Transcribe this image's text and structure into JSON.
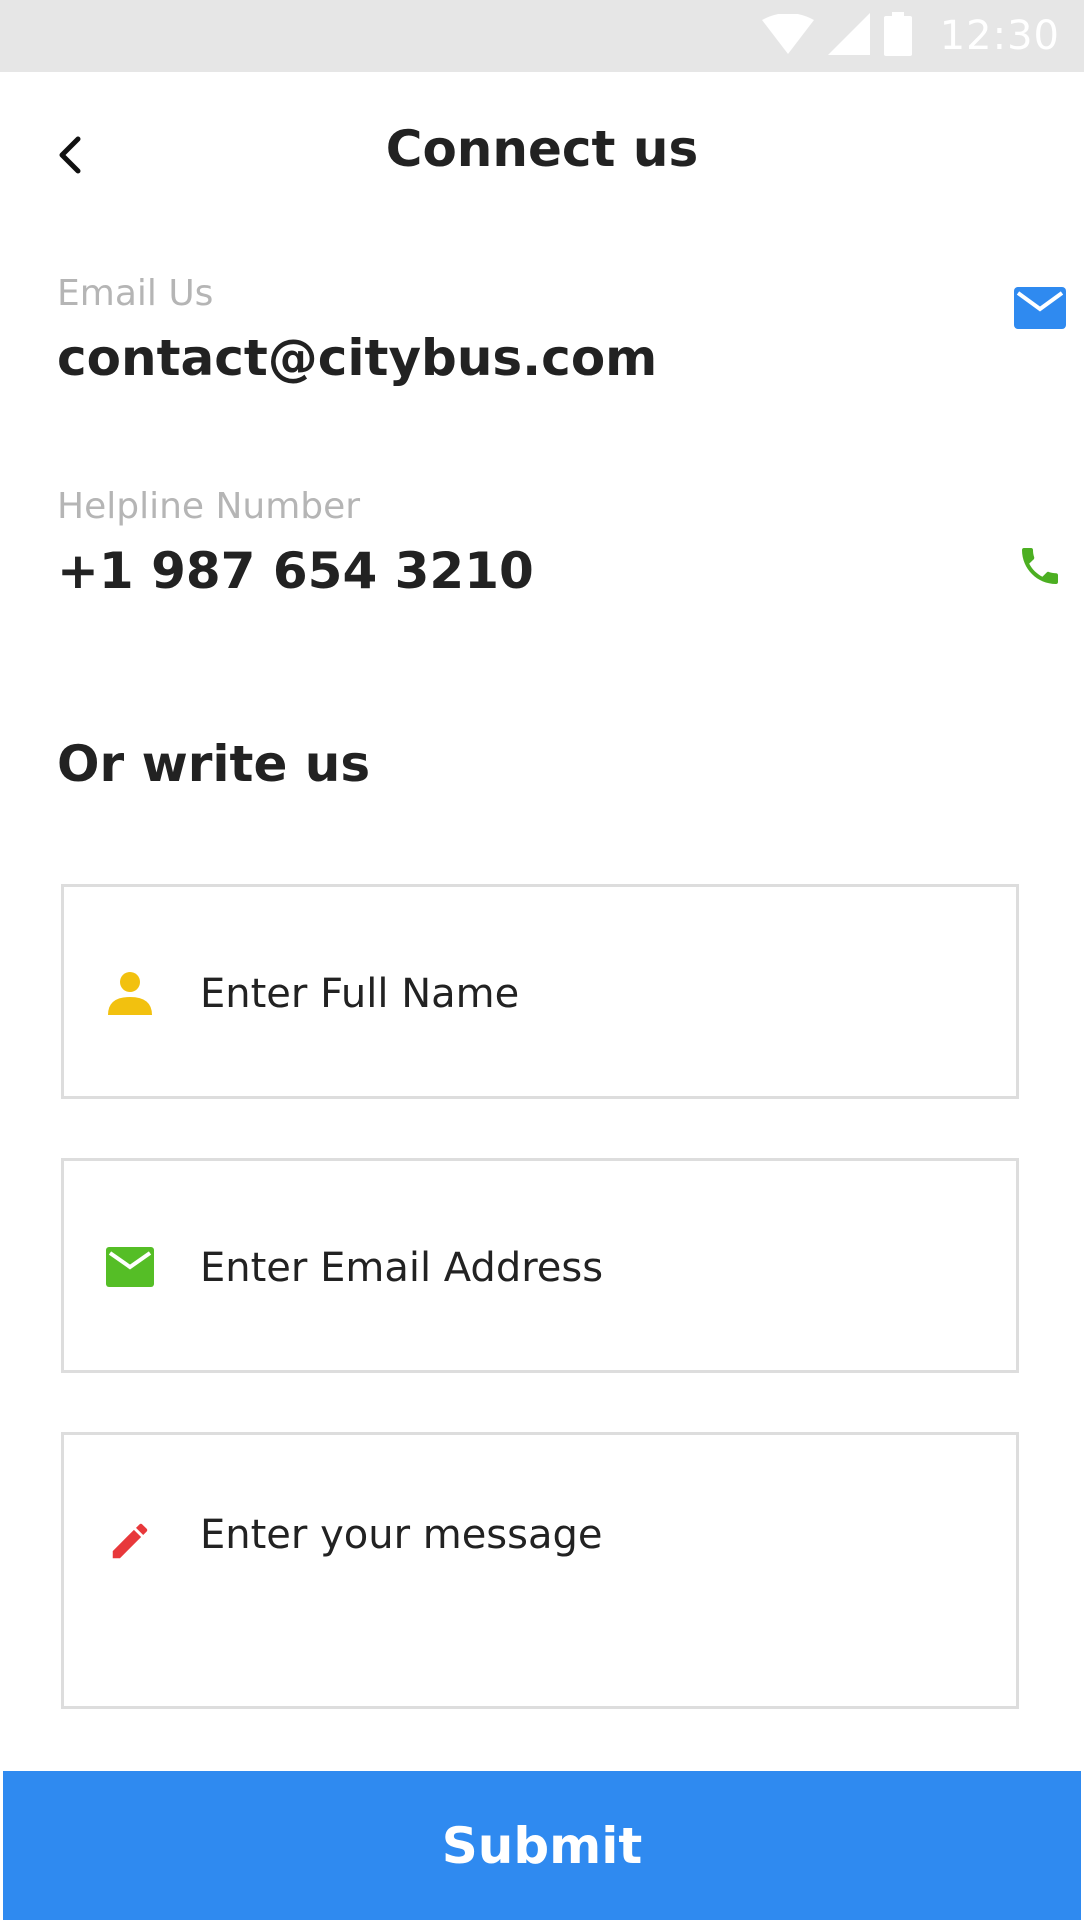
{
  "status_bar": {
    "time": "12:30",
    "icons": [
      "wifi-icon",
      "signal-icon",
      "battery-icon"
    ]
  },
  "header": {
    "title": "Connect us",
    "back_icon": "chevron-left-icon"
  },
  "contacts": {
    "email": {
      "label": "Email Us",
      "value": "contact@citybus.com",
      "icon": "mail-icon",
      "icon_color": "#2f8af0"
    },
    "phone": {
      "label": "Helpline Number",
      "value": "+1 987 654 3210",
      "icon": "phone-icon",
      "icon_color": "#4caf22"
    }
  },
  "form": {
    "title": "Or write us",
    "name": {
      "placeholder": "Enter Full Name",
      "icon": "person-icon",
      "icon_color": "#f2c10f"
    },
    "email": {
      "placeholder": "Enter Email Address",
      "icon": "mail-icon",
      "icon_color": "#55be26"
    },
    "message": {
      "placeholder": "Enter your message",
      "icon": "pencil-icon",
      "icon_color": "#e8383b"
    },
    "submit_label": "Submit",
    "submit_color": "#2f8af0"
  }
}
